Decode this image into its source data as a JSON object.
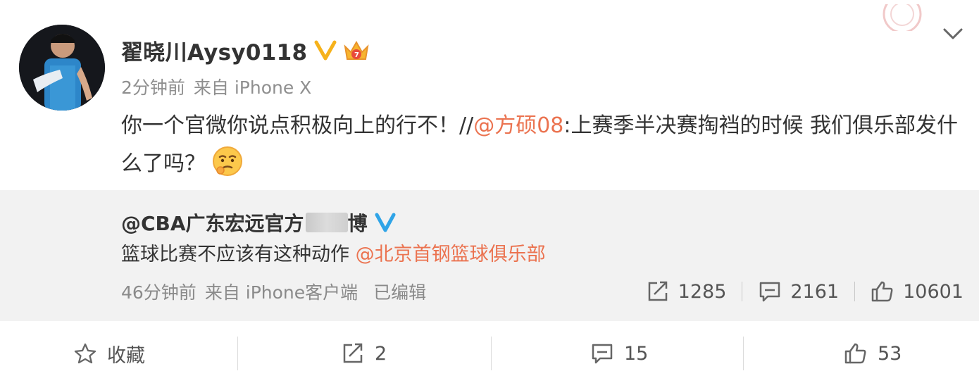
{
  "post": {
    "username": "翟晓川Aysy0118",
    "icons": {
      "verified": "verified-v-icon",
      "crown": "member-crown-icon",
      "expand": "chevron-down-icon"
    },
    "time": "2分钟前",
    "source": "来自 iPhone X",
    "text_before": "你一个官微你说点积极向上的行不！//",
    "mention": "@方硕08",
    "text_after": ":上赛季半决赛掏裆的时候 我们俱乐部发什么了吗？",
    "emoji": "thinking-emoji-icon"
  },
  "repost": {
    "name_visible": "@CBA广东宏远官方",
    "name_tail": "博",
    "text": "篮球比赛不应该有这种动作 ",
    "mention": "@北京首钢篮球俱乐部",
    "time": "46分钟前",
    "source": "来自 iPhone客户端",
    "edited": "已编辑",
    "reposts": "1285",
    "comments": "2161",
    "likes": "10601"
  },
  "bottom": {
    "favorite_label": "收藏",
    "reposts": "2",
    "comments": "15",
    "likes": "53"
  },
  "colors": {
    "accent_orange": "#eb7350",
    "verified": "#f6b21b",
    "repost_bg": "#f2f2f2"
  }
}
